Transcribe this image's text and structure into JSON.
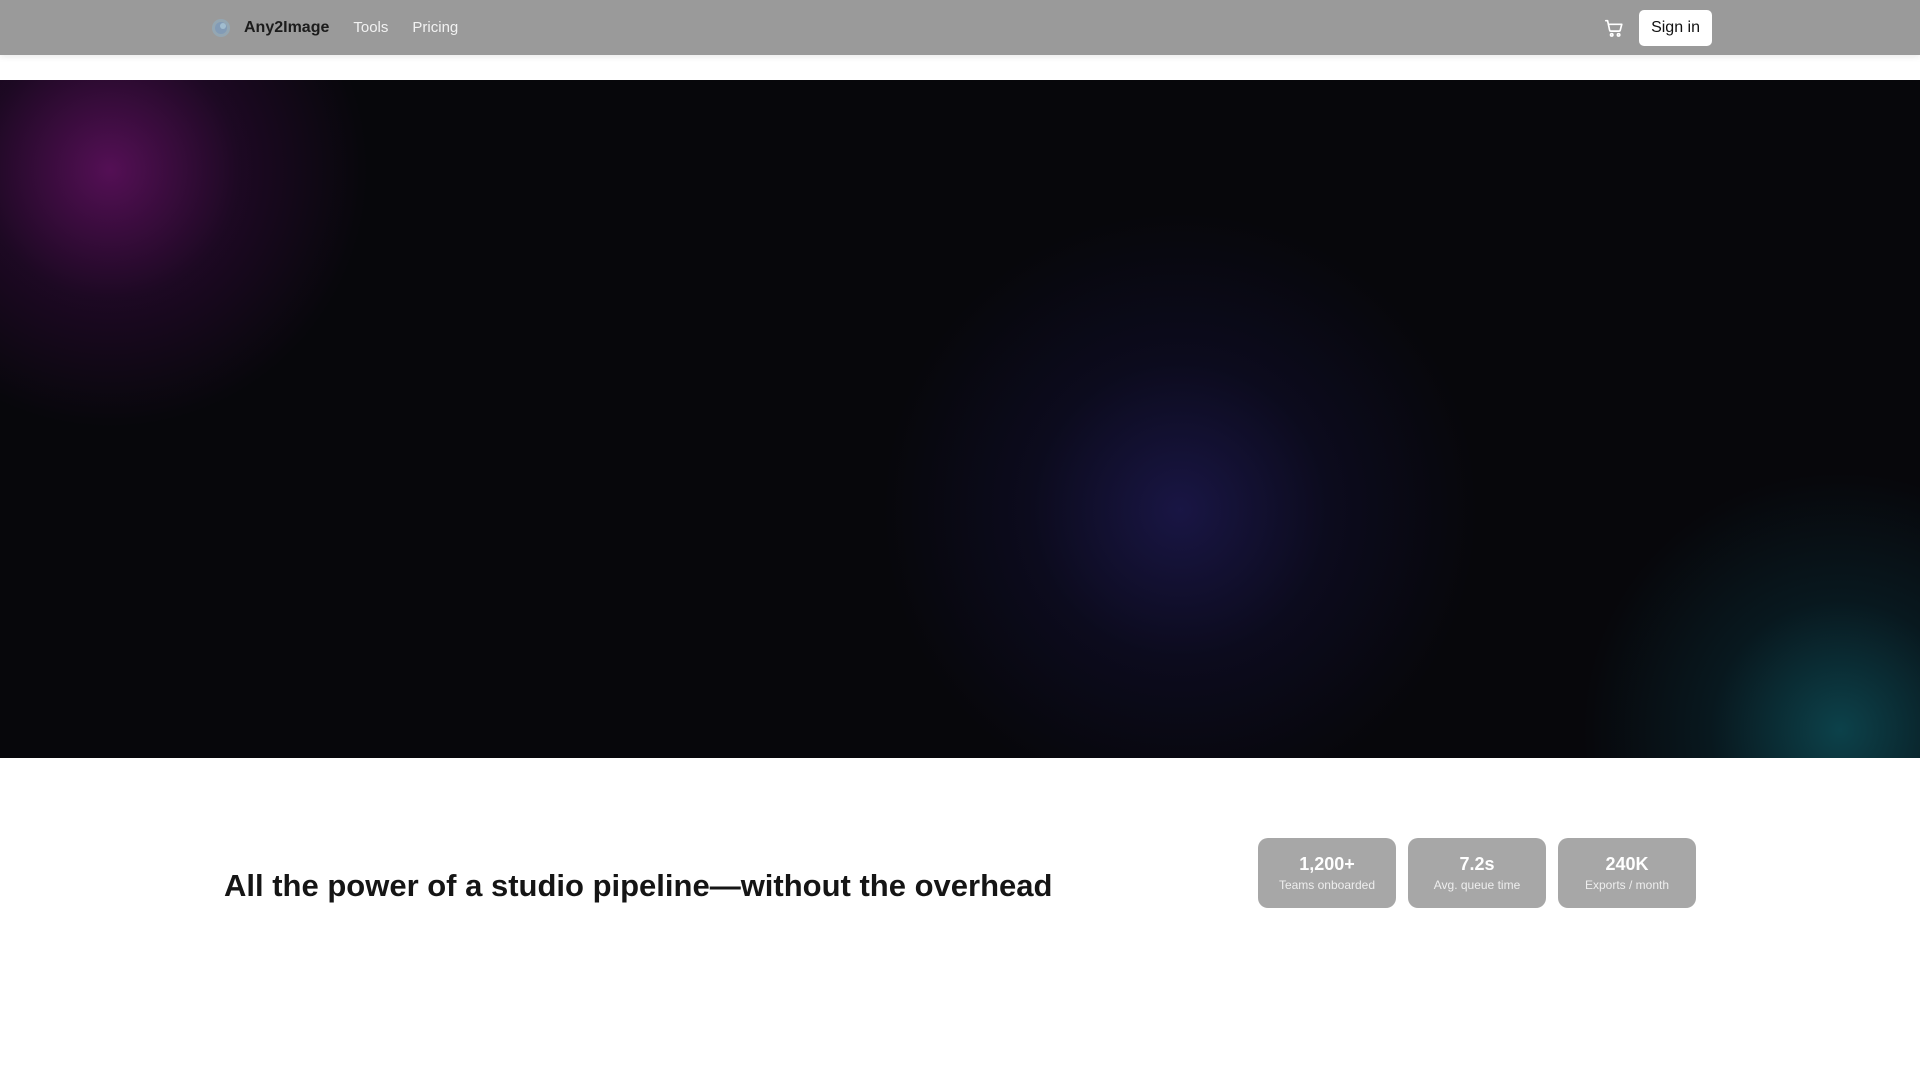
{
  "header": {
    "brand": "Any2Image",
    "nav": [
      "Tools",
      "Pricing"
    ],
    "signin_label": "Sign in",
    "icons": [
      "logo-icon",
      "cart-icon"
    ]
  },
  "hero": {
    "colors": {
      "background": "#07070b",
      "glow_purple": "#6e126e",
      "glow_blue": "#1c184e",
      "glow_teal": "#0e505a"
    }
  },
  "features": {
    "headline": "All the power of a studio pipeline—without the overhead",
    "stats": [
      {
        "value": "1,200+",
        "label": "Teams onboarded"
      },
      {
        "value": "7.2s",
        "label": "Avg. queue time"
      },
      {
        "value": "240K",
        "label": "Exports / month"
      }
    ]
  }
}
